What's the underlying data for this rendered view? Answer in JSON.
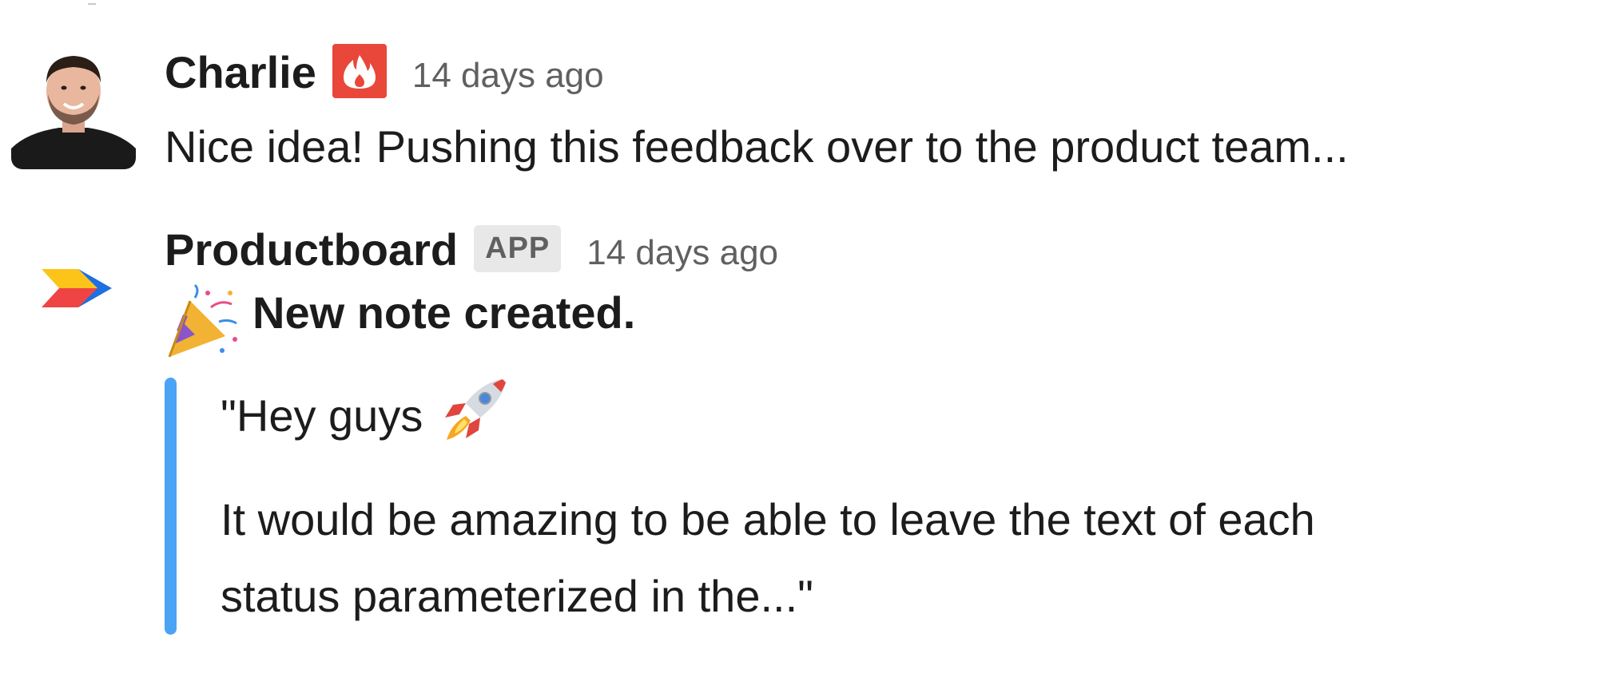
{
  "messages": [
    {
      "sender": "Charlie",
      "status_emoji": "fire-icon",
      "timestamp": "14 days ago",
      "text": "Nice idea! Pushing this feedback over to the product team..."
    },
    {
      "sender": "Productboard",
      "badge": "APP",
      "timestamp": "14 days ago",
      "title_emoji": "party-popper-icon",
      "title": "New note created.",
      "attachment": {
        "accent_color": "#4ba3f5",
        "quote_line1": "\"Hey guys",
        "quote_line1_emoji": "rocket-icon",
        "quote_line2": "It would be amazing to be able to leave the text of each",
        "quote_line3": "status parameterized in the...\""
      }
    }
  ]
}
